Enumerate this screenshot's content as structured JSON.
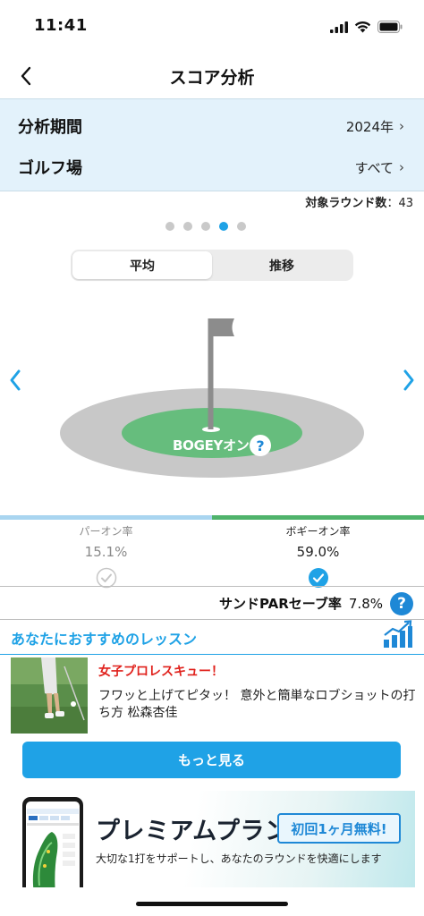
{
  "status_bar": {
    "time": "11:41",
    "icons": [
      "signal-icon",
      "wifi-icon",
      "battery-icon"
    ]
  },
  "nav": {
    "title": "スコア分析",
    "back_icon": "chevron-left-icon"
  },
  "filters": {
    "period_label": "分析期間",
    "period_value": "2024年",
    "course_label": "ゴルフ場",
    "course_value": "すべて",
    "chevron": "›"
  },
  "round_count": {
    "label": "対象ラウンド数",
    "separator": "：",
    "value": "43"
  },
  "pager": {
    "total": 5,
    "active_index": 3
  },
  "segments": {
    "average": "平均",
    "trend": "推移",
    "selected": "average"
  },
  "green_graphic": {
    "label": "BOGEYオン",
    "help": "?"
  },
  "rates": {
    "par_on": {
      "label": "パーオン率",
      "value": "15.1%",
      "checked": false
    },
    "bogey_on": {
      "label": "ボギーオン率",
      "value": "59.0%",
      "checked": true
    }
  },
  "sand_save": {
    "label": "サンドPARセーブ率",
    "value": "7.8%",
    "help": "?"
  },
  "lessons": {
    "header": "あなたにおすすめのレッスン",
    "items": [
      {
        "category": "女子プロレスキュー！",
        "title": "フワッと上げてピタッ！ 意外と簡単なロブショットの打ち方 松森杏佳"
      }
    ],
    "more_button": "もっと見る"
  },
  "premium": {
    "title": "プレミアムプラン",
    "badge": "初回1ヶ月無料!",
    "description": "大切な1打をサポートし、あなたのラウンドを快適にします"
  },
  "colors": {
    "accent": "#1fa2e6",
    "filter_bg": "#e3f2fb",
    "green": "#66bd7d",
    "fringe": "#c8c8c8",
    "flag": "#8c8c8c",
    "lesson_category": "#e0211c"
  }
}
